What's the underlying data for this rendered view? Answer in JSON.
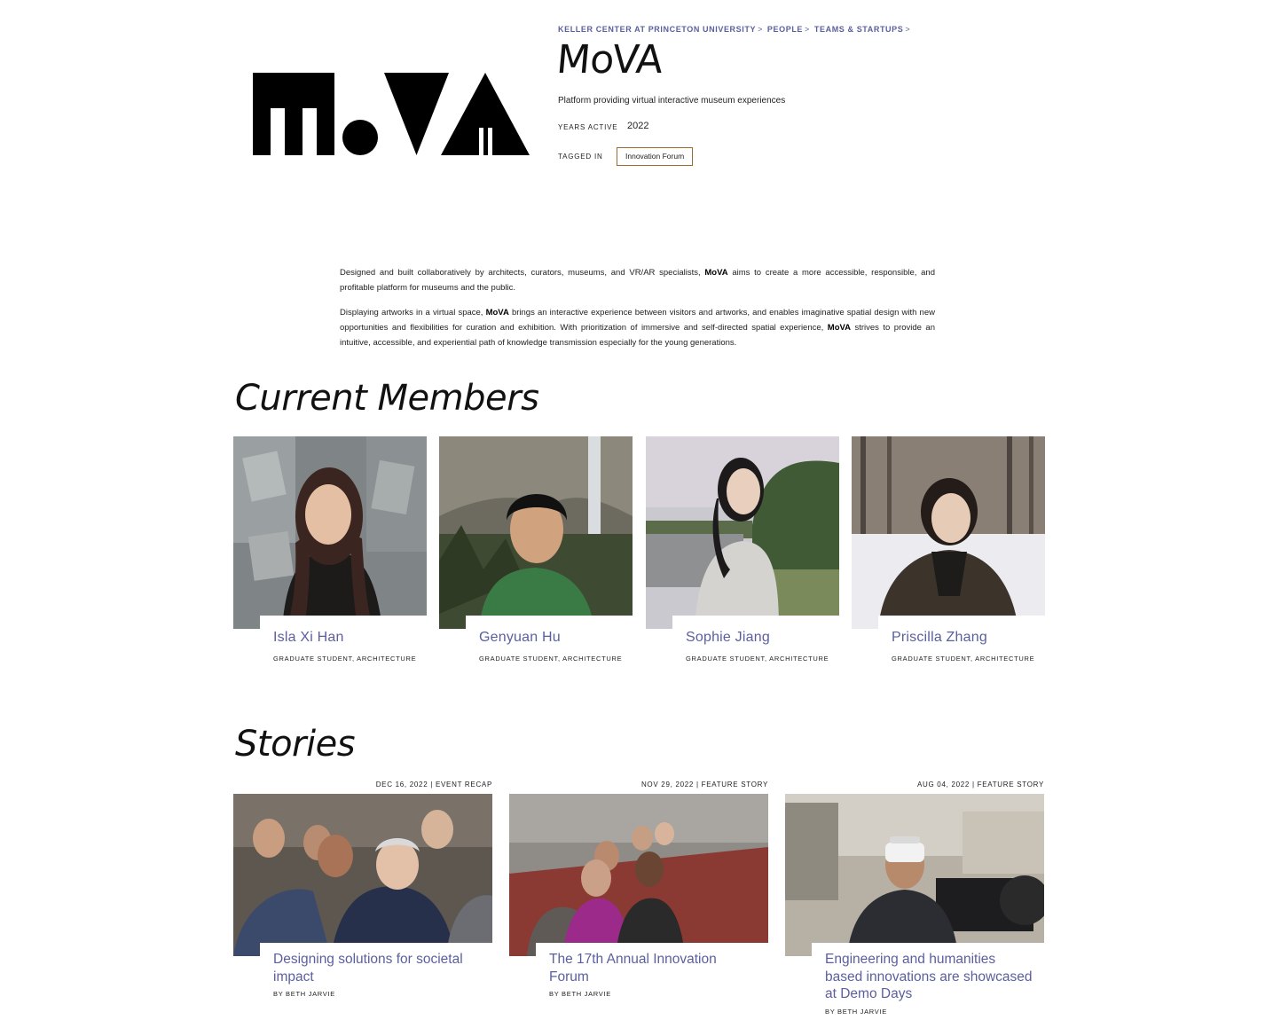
{
  "breadcrumb": {
    "items": [
      "KELLER CENTER AT PRINCETON UNIVERSITY",
      "PEOPLE",
      "TEAMS & STARTUPS"
    ],
    "separator": ">"
  },
  "team": {
    "logo_text": "MoVA",
    "title": "MoVA",
    "tagline": "Platform providing virtual interactive museum experiences",
    "years_active_label": "YEARS ACTIVE",
    "years_active_value": "2022",
    "tagged_in_label": "TAGGED IN",
    "tag": "Innovation Forum"
  },
  "description": {
    "p1": {
      "a": "Designed and built collaboratively by architects, curators, museums, and VR/AR specialists, ",
      "b": "MoVA",
      "c": " aims to create a more accessible, responsible, and profitable platform for museums and the public."
    },
    "p2": {
      "a": "Displaying artworks in a virtual space, ",
      "b": "MoVA",
      "c": " brings an interactive experience between visitors and artworks, and enables imaginative spatial design with new opportunities and flexibilities for curation and exhibition. With prioritization of immersive and self-directed spatial experience, ",
      "d": "MoVA",
      "e": " strives to provide an intuitive, accessible, and experiential path of knowledge transmission especially for the young generations."
    }
  },
  "members": {
    "heading": "Current Members",
    "items": [
      {
        "name": "Isla Xi Han",
        "role": "GRADUATE STUDENT, ARCHITECTURE"
      },
      {
        "name": "Genyuan Hu",
        "role": "GRADUATE STUDENT, ARCHITECTURE"
      },
      {
        "name": "Sophie Jiang",
        "role": "GRADUATE STUDENT, ARCHITECTURE"
      },
      {
        "name": "Priscilla Zhang",
        "role": "GRADUATE STUDENT, ARCHITECTURE"
      }
    ]
  },
  "stories": {
    "heading": "Stories",
    "items": [
      {
        "date": "DEC 16, 2022 | EVENT RECAP",
        "headline": "Designing solutions for societal impact",
        "byline": "BY BETH JARVIE"
      },
      {
        "date": "NOV 29, 2022 | FEATURE STORY",
        "headline": "The 17th Annual Innovation Forum",
        "byline": "BY BETH JARVIE"
      },
      {
        "date": "AUG 04, 2022 | FEATURE STORY",
        "headline": "Engineering and humanities based innovations are showcased at Demo Days",
        "byline": "BY BETH JARVIE"
      }
    ]
  },
  "colors": {
    "link": "#5b5f9e",
    "tag_border": "#9b6a2f",
    "text": "#111111"
  }
}
